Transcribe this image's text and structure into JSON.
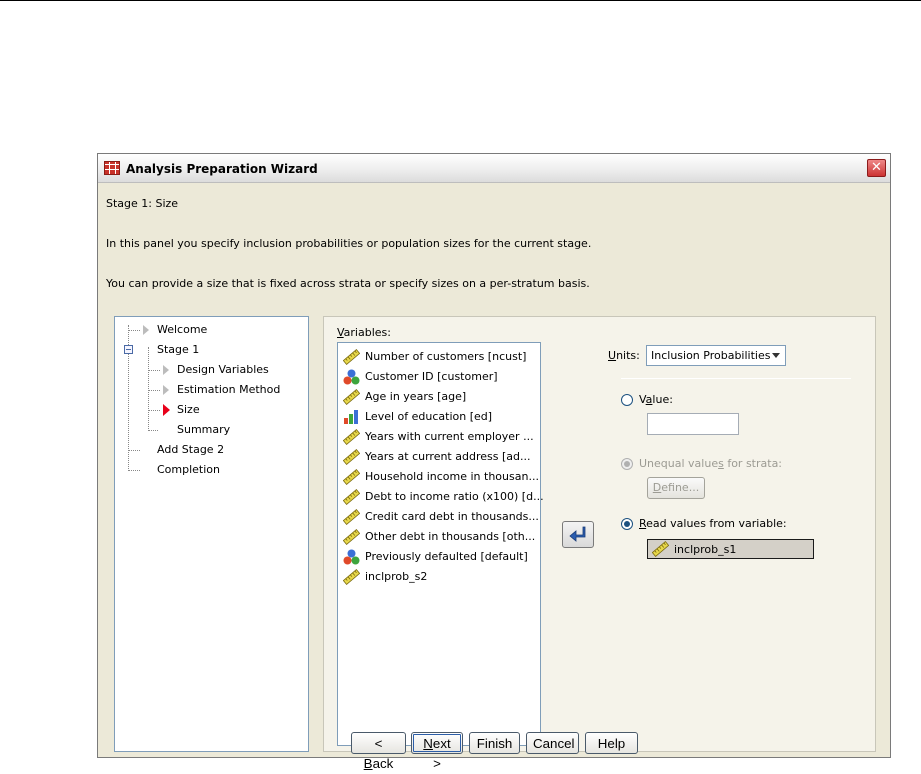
{
  "window": {
    "title": "Analysis Preparation Wizard"
  },
  "header": {
    "stage_title": "Stage 1: Size",
    "description_1": "In this panel you specify inclusion probabilities or population sizes for the current stage.",
    "description_2": "You can provide a size that is fixed across strata or specify sizes on a per-stratum basis."
  },
  "tree": {
    "items": [
      {
        "label": "Welcome"
      },
      {
        "label": "Stage 1"
      },
      {
        "label": "Design Variables"
      },
      {
        "label": "Estimation Method"
      },
      {
        "label": "Size"
      },
      {
        "label": "Summary"
      },
      {
        "label": "Add Stage 2"
      },
      {
        "label": "Completion"
      }
    ]
  },
  "variables": {
    "label_first": "V",
    "label_rest": "ariables:",
    "items": [
      {
        "label": "Number of customers [ncust]",
        "icon": "ruler-icon"
      },
      {
        "label": "Customer ID [customer]",
        "icon": "nominal-icon"
      },
      {
        "label": "Age in years [age]",
        "icon": "ruler-icon"
      },
      {
        "label": "Level of education [ed]",
        "icon": "ordinal-icon"
      },
      {
        "label": "Years with current employer ...",
        "icon": "ruler-icon"
      },
      {
        "label": "Years at current address [ad...",
        "icon": "ruler-icon"
      },
      {
        "label": "Household income in thousan...",
        "icon": "ruler-icon"
      },
      {
        "label": "Debt to income ratio (x100) [d...",
        "icon": "ruler-icon"
      },
      {
        "label": "Credit card debt in thousands...",
        "icon": "ruler-icon"
      },
      {
        "label": "Other debt in thousands [oth...",
        "icon": "ruler-icon"
      },
      {
        "label": "Previously defaulted [default]",
        "icon": "nominal-icon"
      },
      {
        "label": "inclprob_s2",
        "icon": "ruler-icon"
      }
    ]
  },
  "units": {
    "label_first": "U",
    "label_rest": "nits:",
    "selected": "Inclusion Probabilities"
  },
  "options": {
    "value_pre": "V",
    "value_u": "a",
    "value_post": "lue:",
    "value_input": "",
    "unequal_pre": "Unequal value",
    "unequal_u": "s",
    "unequal_post": " for strata:",
    "define_u": "D",
    "define_rest": "efine...",
    "read_u": "R",
    "read_rest": "ead values from variable:",
    "read_value": "inclprob_s1"
  },
  "buttons": {
    "back_pre": "< ",
    "back_u": "B",
    "back_rest": "ack",
    "next_u": "N",
    "next_rest": "ext >",
    "finish": "Finish",
    "cancel": "Cancel",
    "help": "Help"
  },
  "colors": {
    "accent": "#1c5180",
    "selected_marker": "#e8001a"
  }
}
